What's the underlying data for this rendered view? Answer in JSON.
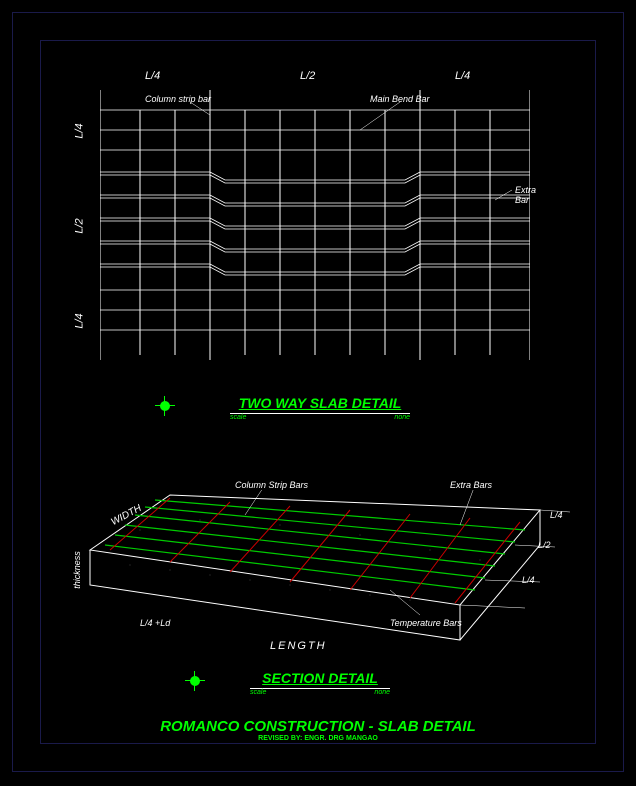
{
  "plan": {
    "top_dims": {
      "d1": "L/4",
      "d2": "L/2",
      "d3": "L/4"
    },
    "left_dims": {
      "d1": "L/4",
      "d2": "L/2",
      "d3": "L/4"
    },
    "labels": {
      "column_strip": "Column strip bar",
      "main_bend": "Main Bend Bar",
      "extra_bar": "Extra Bar"
    }
  },
  "title1": {
    "heading": "TWO WAY SLAB DETAIL",
    "scale_left": "scale",
    "scale_right": "none"
  },
  "iso": {
    "width_label": "WIDTH",
    "thickness_label": "thickness",
    "length_label": "LENGTH",
    "ld_label": "L/4 +Ld",
    "column_strip": "Column Strip Bars",
    "extra_bars": "Extra Bars",
    "temp_bars": "Temperature Bars",
    "right_dims": {
      "d1": "L/4",
      "d2": "L/2",
      "d3": "L/4"
    }
  },
  "title2": {
    "heading": "SECTION DETAIL",
    "scale_left": "scale",
    "scale_right": "none"
  },
  "footer": {
    "main": "ROMANCO CONSTRUCTION - SLAB DETAIL",
    "revised": "REVISED BY: ENGR. DRG MANGAO"
  }
}
